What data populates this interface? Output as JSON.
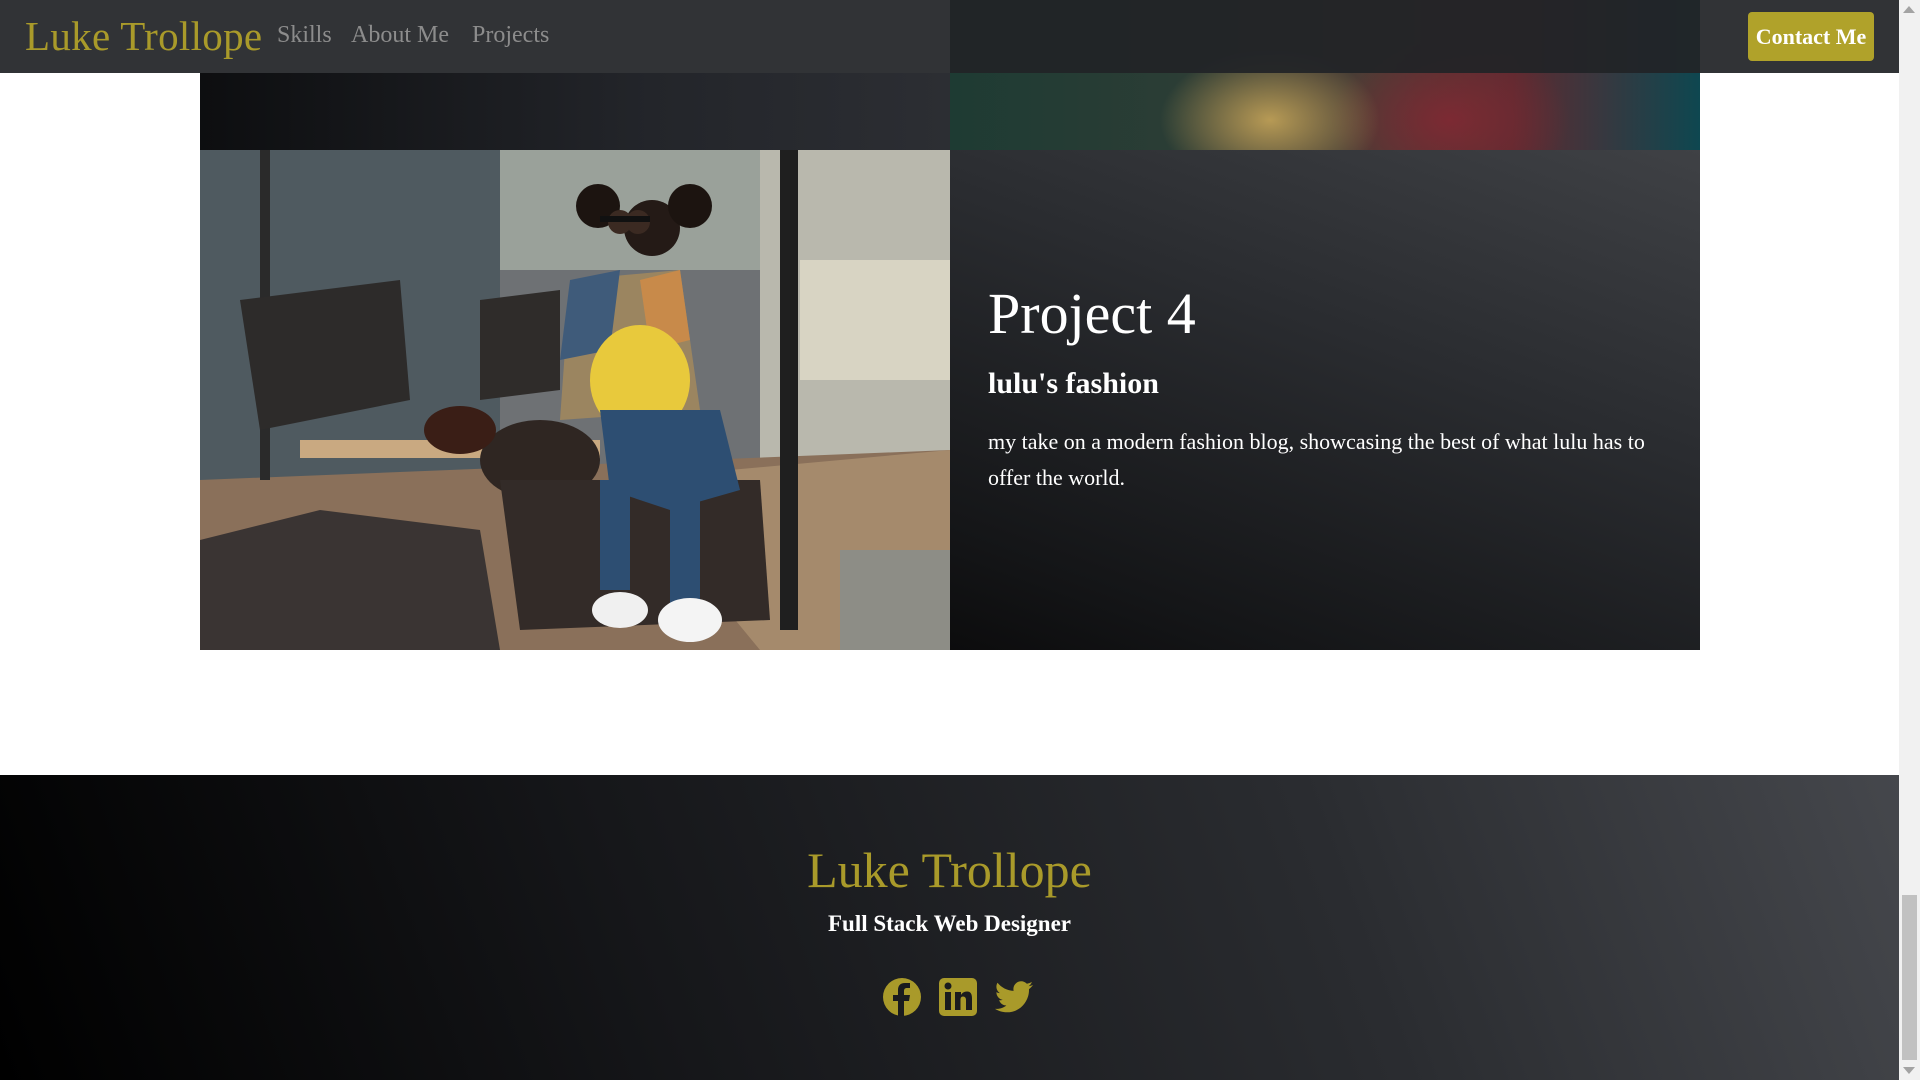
{
  "nav": {
    "brand": "Luke Trollope",
    "links": [
      "Skills",
      "About Me",
      "Projects"
    ],
    "contact_label": "Contact Me"
  },
  "project": {
    "title": "Project 4",
    "subtitle": "lulu's fashion",
    "description": "my take on a modern fashion blog, showcasing the best of what lulu has to offer the world."
  },
  "footer": {
    "brand": "Luke Trollope",
    "tagline": "Full Stack Web Designer",
    "socials": [
      "facebook-icon",
      "linkedin-icon",
      "twitter-icon"
    ]
  },
  "colors": {
    "accent": "#b0a22a",
    "brand_text": "#a99a2a",
    "dark_bg": "#212327"
  }
}
